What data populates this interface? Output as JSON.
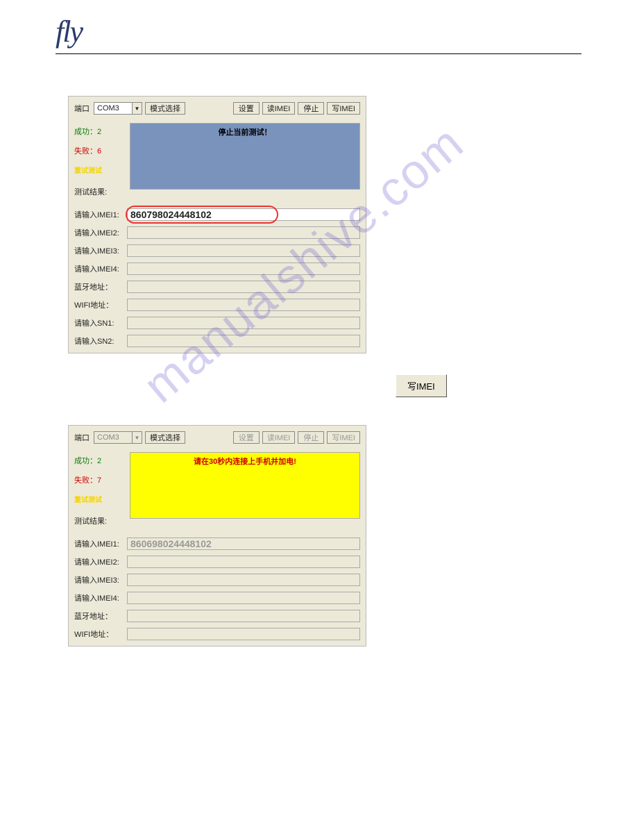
{
  "logo": "fly",
  "watermark": "manualshive.com",
  "big_button": "写IMEI",
  "panel1": {
    "port_label": "端口",
    "port_value": "COM3",
    "mode_btn": "模式选择",
    "settings_btn": "设置",
    "read_btn": "读IMEI",
    "stop_btn": "停止",
    "write_btn": "写IMEI",
    "success_label": "成功：",
    "success_val": "2",
    "fail_label": "失败：",
    "fail_val": "6",
    "test_hint": "重试测试",
    "result_label": "测试结果:",
    "message": "停止当前测试！",
    "fields": {
      "imei1_label": "请输入IMEI1:",
      "imei1_value": "860798024448102",
      "imei2_label": "请输入IMEI2:",
      "imei3_label": "请输入IMEI3:",
      "imei4_label": "请输入IMEI4:",
      "bt_label": "蓝牙地址：",
      "wifi_label": "WIFI地址：",
      "sn1_label": "请输入SN1:",
      "sn2_label": "请输入SN2:"
    }
  },
  "panel2": {
    "port_label": "端口",
    "port_value": "COM3",
    "mode_btn": "模式选择",
    "settings_btn": "设置",
    "read_btn": "读IMEI",
    "stop_btn": "停止",
    "write_btn": "写IMEI",
    "success_label": "成功：",
    "success_val": "2",
    "fail_label": "失败：",
    "fail_val": "7",
    "test_hint": "重试测试",
    "result_label": "测试结果:",
    "message": "请在30秒内连接上手机并加电!",
    "fields": {
      "imei1_label": "请输入IMEI1:",
      "imei1_value": "860698024448102",
      "imei2_label": "请输入IMEI2:",
      "imei3_label": "请输入IMEI3:",
      "imei4_label": "请输入IMEI4:",
      "bt_label": "蓝牙地址：",
      "wifi_label": "WIFI地址："
    }
  }
}
